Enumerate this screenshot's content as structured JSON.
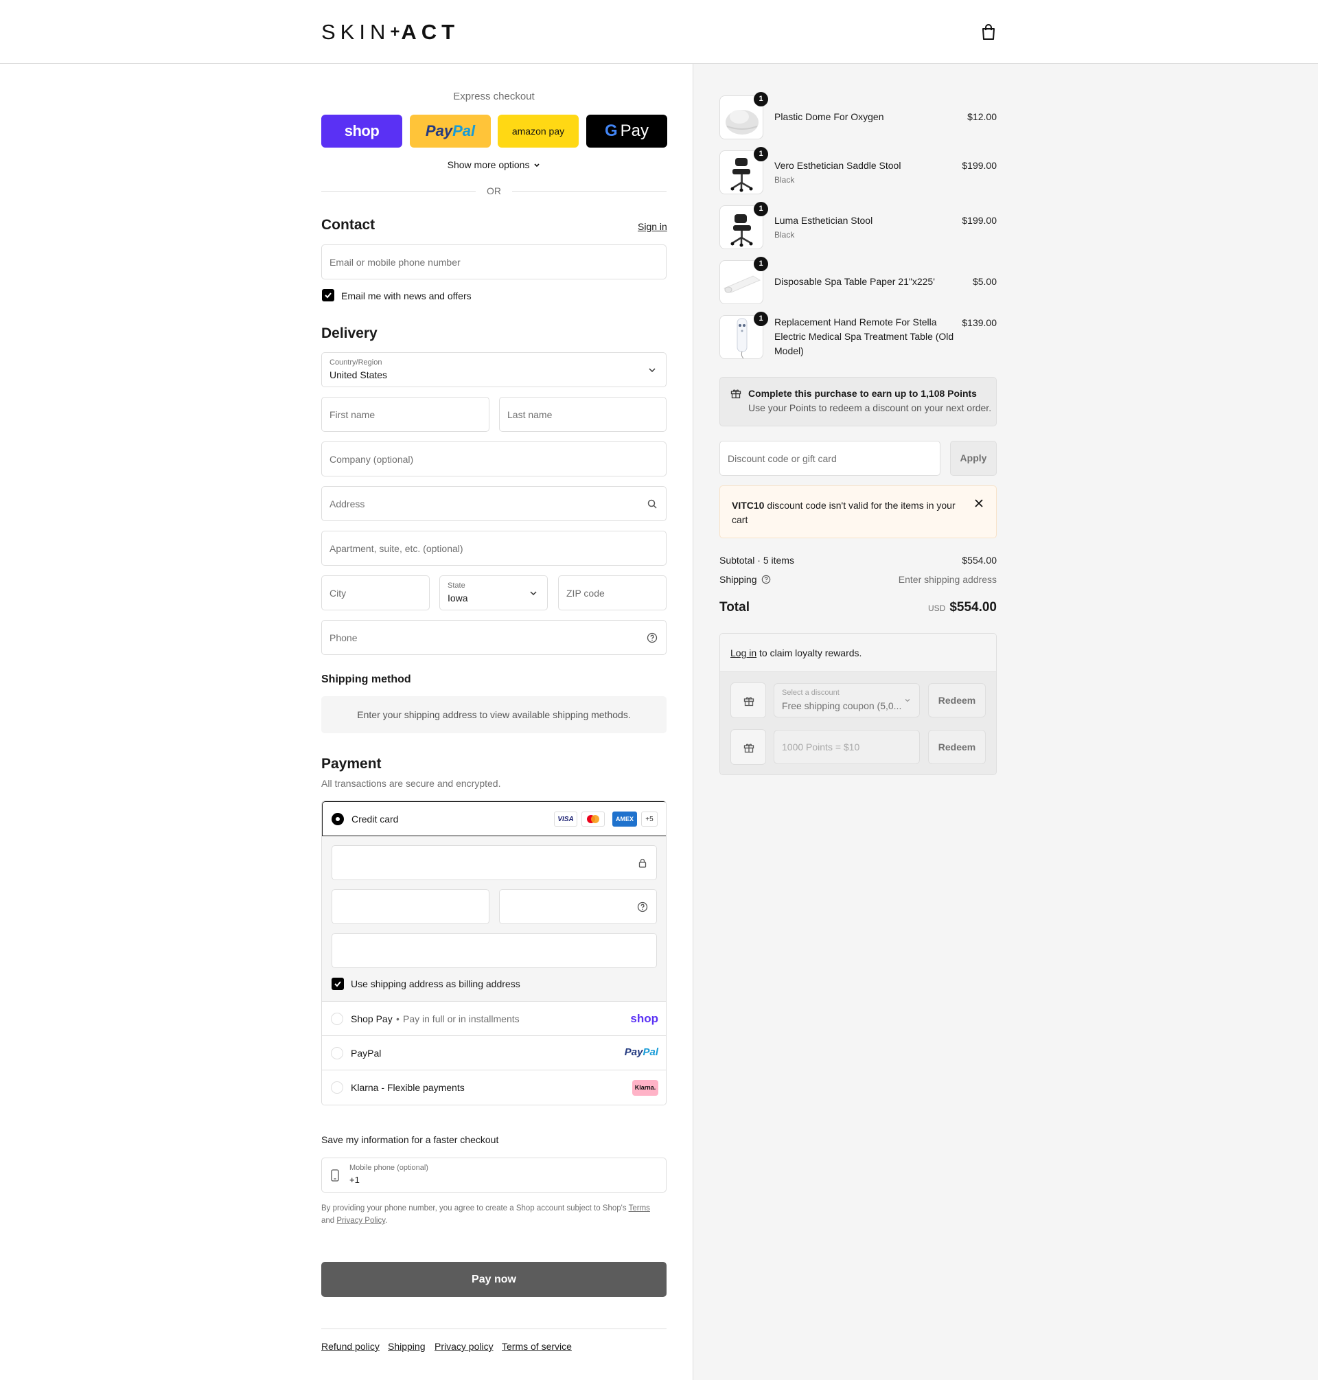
{
  "header": {
    "logo_left": "SKIN",
    "logo_mid": "+",
    "logo_right": "ACT"
  },
  "express": {
    "title": "Express checkout",
    "shop_label": "shop",
    "paypal_a": "Pay",
    "paypal_b": "Pal",
    "amazon_label": "amazon pay",
    "gpay_g": "G",
    "gpay_label": "Pay",
    "more_options": "Show more options",
    "or": "OR"
  },
  "contact": {
    "title": "Contact",
    "sign_in": "Sign in",
    "email_placeholder": "Email or mobile phone number",
    "news_label": "Email me with news and offers"
  },
  "delivery": {
    "title": "Delivery",
    "country_label": "Country/Region",
    "country_value": "United States",
    "first_name": "First name",
    "last_name": "Last name",
    "company": "Company (optional)",
    "address": "Address",
    "apartment": "Apartment, suite, etc. (optional)",
    "city": "City",
    "state_label": "State",
    "state_value": "Iowa",
    "zip": "ZIP code",
    "phone": "Phone"
  },
  "shipping_method": {
    "title": "Shipping method",
    "info": "Enter your shipping address to view available shipping methods."
  },
  "payment": {
    "title": "Payment",
    "subtitle": "All transactions are secure and encrypted.",
    "credit_card": "Credit card",
    "brands": [
      "VISA",
      "",
      "AMEX",
      "+5"
    ],
    "billing_label": "Use shipping address as billing address",
    "shop_pay": "Shop Pay",
    "shop_pay_sub": "Pay in full or in installments",
    "shop_pay_logo": "shop",
    "paypal": "PayPal",
    "paypal_logo_a": "Pay",
    "paypal_logo_b": "Pal",
    "klarna": "Klarna - Flexible payments",
    "klarna_logo": "Klarna."
  },
  "save_info": {
    "title": "Save my information for a faster checkout",
    "mobile_label": "Mobile phone (optional)",
    "mobile_value": "+1",
    "legal_a": "By providing your phone number, you agree to create a Shop account subject to Shop's ",
    "terms": "Terms",
    "legal_b": "and ",
    "privacy": "Privacy Policy",
    "legal_c": "."
  },
  "pay_now": "Pay now",
  "footer": [
    "Refund policy",
    "Shipping",
    "Privacy policy",
    "Terms of service"
  ],
  "items": [
    {
      "qty": "1",
      "name": "Plastic Dome For Oxygen",
      "variant": "",
      "price": "$12.00"
    },
    {
      "qty": "1",
      "name": "Vero Esthetician Saddle Stool",
      "variant": "Black",
      "price": "$199.00"
    },
    {
      "qty": "1",
      "name": "Luma Esthetician Stool",
      "variant": "Black",
      "price": "$199.00"
    },
    {
      "qty": "1",
      "name": "Disposable Spa Table Paper 21\"x225'",
      "variant": "",
      "price": "$5.00"
    },
    {
      "qty": "1",
      "name_l1": "Replacement Hand Remote For Stella",
      "name_l2": "Electric Medical Spa Treatment Table (Old",
      "name_l3": "Model)",
      "variant": "",
      "price": "$139.00"
    }
  ],
  "points": {
    "title": "Complete this purchase to earn up to 1,108 Points",
    "subtitle": "Use your Points to redeem a discount on your next order."
  },
  "discount": {
    "placeholder": "Discount code or gift card",
    "apply": "Apply",
    "error_code": "VITC10",
    "error_msg_1": " discount code isn't valid for the items in your",
    "error_msg_2": "cart"
  },
  "totals": {
    "subtotal_label": "Subtotal · 5 items",
    "subtotal_value": "$554.00",
    "shipping_label": "Shipping",
    "shipping_value": "Enter shipping address",
    "total_label": "Total",
    "currency": "USD",
    "total_value": "$554.00"
  },
  "loyalty": {
    "login": "Log in",
    "login_rest": " to claim loyalty rewards.",
    "select_label": "Select a discount",
    "select_value": "Free shipping coupon (5,0...",
    "redeem": "Redeem",
    "points_placeholder": "1000 Points = $10"
  }
}
